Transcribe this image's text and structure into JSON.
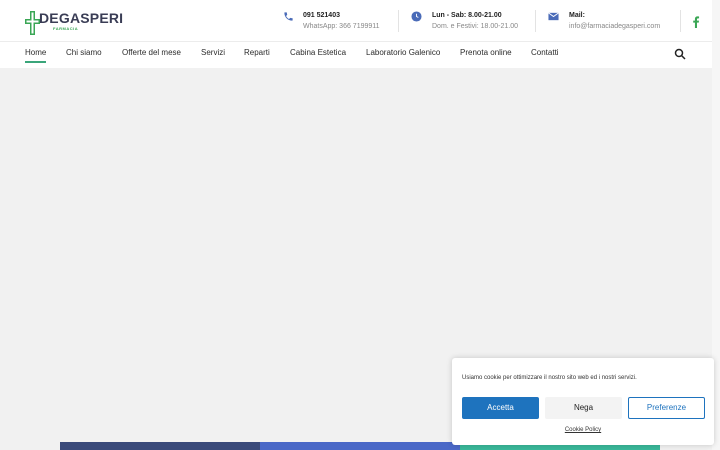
{
  "header": {
    "logo": {
      "brand": "DEGASPERI",
      "subtitle": "FARMACIA"
    },
    "phone": {
      "icon": "phone-icon",
      "title": "091 521403",
      "subtitle": "WhatsApp: 366 7199911"
    },
    "hours": {
      "icon": "clock-icon",
      "title": "Lun - Sab: 8.00-21.00",
      "subtitle": "Dom. e Festivi: 18.00-21.00"
    },
    "mail": {
      "icon": "mail-icon",
      "title": "Mail:",
      "subtitle": "info@farmaciadegasperi.com"
    },
    "social": {
      "icon": "facebook-icon",
      "color": "#3aa655"
    }
  },
  "nav": {
    "items": [
      {
        "label": "Home",
        "active": true
      },
      {
        "label": "Chi siamo"
      },
      {
        "label": "Offerte del mese"
      },
      {
        "label": "Servizi"
      },
      {
        "label": "Reparti"
      },
      {
        "label": "Cabina Estetica"
      },
      {
        "label": "Laboratorio Galenico"
      },
      {
        "label": "Prenota online"
      },
      {
        "label": "Contatti"
      }
    ],
    "search_icon": "search-icon",
    "active_color": "#3aa57a"
  },
  "banners": [
    {
      "color": "#3a4a7a"
    },
    {
      "color": "#4a68c7"
    },
    {
      "color": "#3ab89a"
    }
  ],
  "cookie": {
    "message": "Usiamo cookie per ottimizzare il nostro sito web ed i nostri servizi.",
    "accept": "Accetta",
    "deny": "Nega",
    "preferences": "Preferenze",
    "policy": "Cookie Policy",
    "accent": "#1e73be"
  }
}
